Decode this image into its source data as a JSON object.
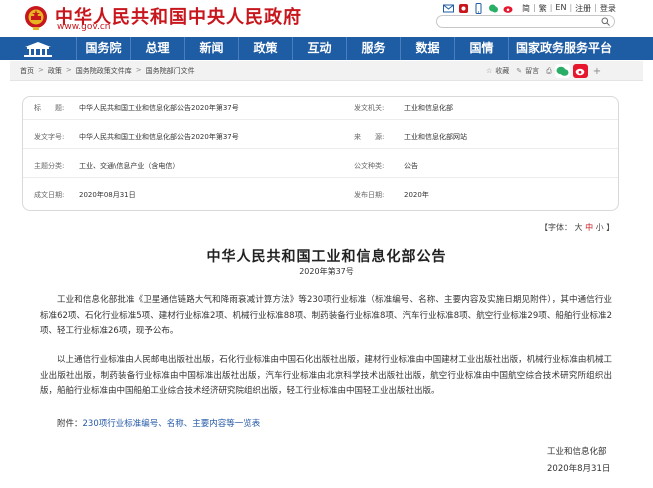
{
  "header": {
    "site_title": "中华人民共和国中央人民政府",
    "site_url": "www.gov.cn",
    "lang_links": [
      "简",
      "繁",
      "EN",
      "注册",
      "登录"
    ],
    "colors": {
      "brand_red": "#c8161d",
      "nav_blue": "#1e5ca3"
    }
  },
  "nav": {
    "items": [
      "国务院",
      "总理",
      "新闻",
      "政策",
      "互动",
      "服务",
      "数据",
      "国情",
      "国家政务服务平台"
    ]
  },
  "breadcrumb": {
    "items": [
      "首页",
      "政策",
      "国务院政策文件库",
      "国务院部门文件"
    ],
    "tools": {
      "favorite": "收藏",
      "message": "留言"
    }
  },
  "info": {
    "title_label": "标　　题:",
    "title_value": "中华人民共和国工业和信息化部公告2020年第37号",
    "issuer_label": "发文机关:",
    "issuer_value": "工业和信息化部",
    "docno_label": "发文字号:",
    "docno_value": "中华人民共和国工业和信息化部公告2020年第37号",
    "source_label": "来　　源:",
    "source_value": "工业和信息化部网站",
    "topic_label": "主题分类:",
    "topic_value": "工业、交通\\信息产业（含电信）",
    "type_label": "公文种类:",
    "type_value": "公告",
    "written_label": "成文日期:",
    "written_value": "2020年08月31日",
    "published_label": "发布日期:",
    "published_value": "2020年"
  },
  "font_selector": {
    "prefix": "【字体：",
    "large": "大",
    "medium": "中",
    "small": "小",
    "suffix": "】"
  },
  "article": {
    "title": "中华人民共和国工业和信息化部公告",
    "number": "2020年第37号",
    "para1": "工业和信息化部批准《卫星通信链路大气和降雨衰减计算方法》等230项行业标准（标准编号、名称、主要内容及实施日期见附件），其中通信行业标准62项、石化行业标准5项、建材行业标准2项、机械行业标准88项、制药装备行业标准8项、汽车行业标准8项、航空行业标准29项、船舶行业标准2项、轻工行业标准26项，现予公布。",
    "para2": "以上通信行业标准由人民邮电出版社出版，石化行业标准由中国石化出版社出版，建材行业标准由中国建材工业出版社出版，机械行业标准由机械工业出版社出版，制药装备行业标准由中国标准出版社出版，汽车行业标准由北京科学技术出版社出版，航空行业标准由中国航空综合技术研究所组织出版，船舶行业标准由中国船舶工业综合技术经济研究院组织出版，轻工行业标准由中国轻工业出版社出版。",
    "attachment_label": "附件：",
    "attachment_link": "230项行业标准编号、名称、主要内容等一览表",
    "signature_org": "工业和信息化部",
    "signature_date": "2020年8月31日"
  }
}
